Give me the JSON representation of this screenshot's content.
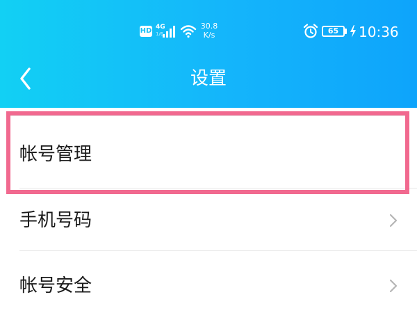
{
  "status_bar": {
    "hd_badge": "HD",
    "network_type": "4G",
    "network_sub": "1/6",
    "speed_value": "30.8",
    "speed_unit": "K/s",
    "battery_level": "65",
    "time": "10:36",
    "icons": [
      "hd-icon",
      "signal-icon",
      "wifi-icon",
      "alarm-icon",
      "battery-icon",
      "charging-icon"
    ]
  },
  "title_bar": {
    "title": "设置",
    "back_icon": "chevron-left-icon"
  },
  "settings_list": {
    "items": [
      {
        "label": "帐号管理",
        "highlighted": true,
        "has_chevron": false
      },
      {
        "label": "手机号码",
        "highlighted": false,
        "has_chevron": true
      },
      {
        "label": "帐号安全",
        "highlighted": false,
        "has_chevron": true
      }
    ]
  },
  "colors": {
    "header_start": "#12d0f4",
    "header_end": "#0ea4fb",
    "highlight_border": "#f1698f",
    "text": "#1a1a1a",
    "chevron": "#b5b5b5",
    "divider": "#e7e7e7"
  }
}
